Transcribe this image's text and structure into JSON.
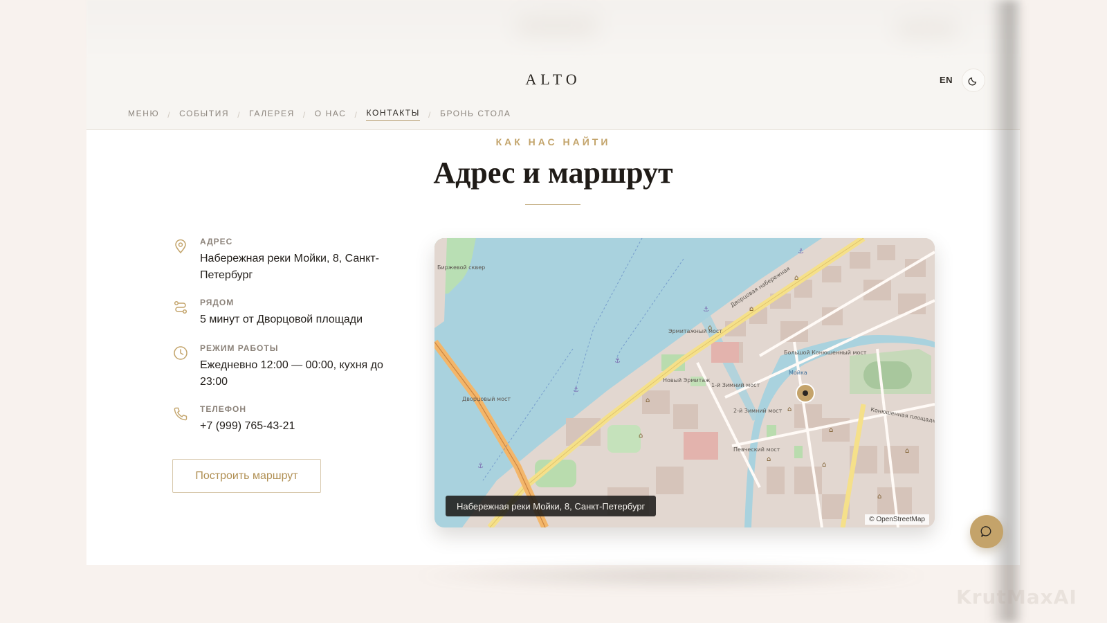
{
  "header": {
    "logo": "ALTO",
    "lang": "EN",
    "theme_icon": "moon-icon"
  },
  "nav": {
    "items": [
      {
        "label": "МЕНЮ"
      },
      {
        "label": "СОБЫТИЯ"
      },
      {
        "label": "ГАЛЕРЕЯ"
      },
      {
        "label": "О НАС"
      },
      {
        "label": "КОНТАКТЫ",
        "active": true
      },
      {
        "label": "БРОНЬ СТОЛА"
      }
    ],
    "separator": "/"
  },
  "section": {
    "eyebrow": "КАК НАС НАЙТИ",
    "title": "Адрес и маршрут"
  },
  "info": {
    "address": {
      "label": "АДРЕС",
      "value": "Набережная реки Мойки, 8, Санкт-Петербург",
      "icon": "location-pin-icon"
    },
    "nearby": {
      "label": "РЯДОМ",
      "value": "5 минут от Дворцовой площади",
      "icon": "route-icon"
    },
    "hours": {
      "label": "РЕЖИМ РАБОТЫ",
      "value": "Ежедневно 12:00 — 00:00, кухня до 23:00",
      "icon": "clock-icon"
    },
    "phone": {
      "label": "ТЕЛЕФОН",
      "value": "+7 (999) 765-43-21",
      "icon": "phone-icon"
    }
  },
  "route_button": {
    "label": "Построить маршрут"
  },
  "map": {
    "caption": "Набережная реки Мойки, 8, Санкт-Петербург",
    "attribution": "© OpenStreetMap",
    "labels": {
      "birzhevoy": "Биржевой сквер",
      "dvortsovy": "Дворцовый мост",
      "ermitazhny": "Эрмитажный мост",
      "novy_ermitazh": "Новый Эрмитаж",
      "zimny1": "1-й Зимний мост",
      "zimny2": "2-й Зимний мост",
      "pevchesky": "Певческий мост",
      "bolshoy_konyushenny": "Большой Конюшенный мост",
      "moika": "Мойка",
      "dvortsovaya_nab": "Дворцовая набережная",
      "konyushennaya": "Конюшенная площадь"
    },
    "colors": {
      "water": "#a9d2de",
      "land": "#e2d6cf",
      "road": "#f5e08a",
      "marker": "#c4a36a"
    }
  },
  "chat": {
    "icon": "chat-bubble-icon"
  },
  "watermark": "KrutMaxAI"
}
